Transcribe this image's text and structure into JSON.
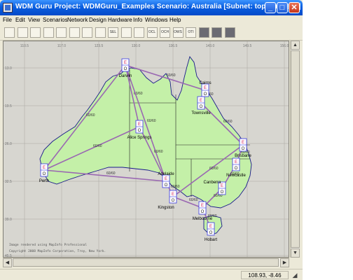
{
  "window": {
    "title": "WDM Guru Project: WDMGuru_Examples Scenario: Australia  [Subnet: top.Australia]",
    "minimize": "_",
    "maximize": "□",
    "close": "✕"
  },
  "menu": [
    "File",
    "Edit",
    "View",
    "Scenarios",
    "Network",
    "Design",
    "Hardware",
    "Info",
    "Windows",
    "Help"
  ],
  "toolbar": {
    "tools": [
      {
        "name": "select-tool-icon",
        "label": ""
      },
      {
        "name": "zoom-in-icon",
        "label": ""
      },
      {
        "name": "zoom-out-icon",
        "label": ""
      },
      {
        "name": "zoom-window-icon",
        "label": ""
      },
      {
        "name": "zoom-fit-icon",
        "label": ""
      },
      {
        "name": "pan-icon",
        "label": ""
      },
      {
        "name": "node-tool-icon",
        "label": ""
      },
      {
        "name": "link-tool-icon",
        "label": ""
      },
      {
        "name": "sel-tool-icon",
        "label": "SEL"
      },
      {
        "name": "grid-tool-icon",
        "label": ""
      },
      {
        "name": "route-tool-icon",
        "label": ""
      },
      {
        "name": "ocl-tool-icon",
        "label": "OCL"
      },
      {
        "name": "och-tool-icon",
        "label": "OCH"
      },
      {
        "name": "ows-tool-icon",
        "label": "OWS"
      },
      {
        "name": "oti-tool-icon",
        "label": "OTI"
      },
      {
        "name": "report-tool-icon",
        "label": ""
      },
      {
        "name": "layout-tool-icon",
        "label": ""
      },
      {
        "name": "export-tool-icon",
        "label": ""
      }
    ]
  },
  "map": {
    "grid_labels_top": [
      "110.5",
      "117.0",
      "123.5",
      "130.0",
      "136.5",
      "143.0",
      "149.5",
      "156.0"
    ],
    "grid_labels_left": [
      "13.0",
      "19.5",
      "26.0",
      "32.5",
      "39.0",
      "45.5"
    ],
    "node_text_top": "E",
    "node_text_bottom": "O",
    "cities": [
      {
        "id": "darwin",
        "label": "Darwin"
      },
      {
        "id": "cairns",
        "label": "Cairns"
      },
      {
        "id": "townsville",
        "label": "Townsville"
      },
      {
        "id": "alice",
        "label": "Alice Springs"
      },
      {
        "id": "perth",
        "label": "Perth"
      },
      {
        "id": "brisbane",
        "label": "Brisbane"
      },
      {
        "id": "newcastle",
        "label": "Newcastle"
      },
      {
        "id": "adelaide",
        "label": "Adelaide"
      },
      {
        "id": "kingston",
        "label": "Kingston"
      },
      {
        "id": "canberra",
        "label": "Canberra"
      },
      {
        "id": "melbourne",
        "label": "Melbourne"
      },
      {
        "id": "hobart",
        "label": "Hobart"
      }
    ],
    "link_label": "60/60",
    "credit_line1": "Image rendered using MapInfo Professional",
    "credit_line2": "Copyright 2008 MapInfo Corporation, Troy, New York.",
    "colors": {
      "land": "#c4f0a8",
      "water": "#d8d7d1",
      "link": "#9a68b2",
      "coast": "#1a1a8a",
      "node_border": "#3a3ae0",
      "node_e": "#d0205a"
    }
  },
  "status": {
    "coordinates": "108.93, -8.46",
    "icon": "resize-grip-icon"
  }
}
